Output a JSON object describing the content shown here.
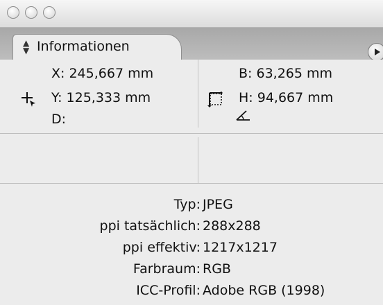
{
  "window": {
    "controls": [
      "close-button",
      "minimize-button",
      "zoom-button"
    ]
  },
  "panel": {
    "tab_label": "Informationen",
    "tab_icon": "up-down-arrows-icon",
    "menu_icon": "panel-menu-icon"
  },
  "position": {
    "icon": "crosshair-cursor-icon",
    "x": "X: 245,667 mm",
    "y": "Y: 125,333 mm",
    "d": "D:"
  },
  "size": {
    "icon": "frame-size-icon",
    "angle_icon": "angle-icon",
    "b": "B: 63,265 mm",
    "h": "H: 94,667 mm"
  },
  "properties": [
    {
      "label": "Typ:",
      "value": "JPEG"
    },
    {
      "label": "ppi tatsächlich:",
      "value": "288x288"
    },
    {
      "label": "ppi effektiv:",
      "value": "1217x1217"
    },
    {
      "label": "Farbraum:",
      "value": "RGB"
    },
    {
      "label": "ICC-Profil:",
      "value": "Adobe RGB (1998)"
    }
  ]
}
